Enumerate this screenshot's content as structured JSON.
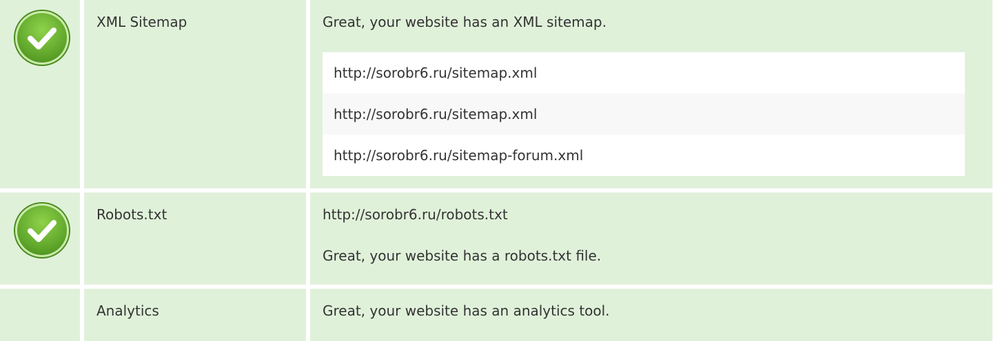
{
  "rows": [
    {
      "label": "XML Sitemap",
      "status_icon": "check-circle-icon",
      "message": "Great, your website has an XML sitemap.",
      "urls": [
        "http://sorobr6.ru/sitemap.xml",
        "http://sorobr6.ru/sitemap.xml",
        "http://sorobr6.ru/sitemap-forum.xml"
      ]
    },
    {
      "label": "Robots.txt",
      "status_icon": "check-circle-icon",
      "url": "http://sorobr6.ru/robots.txt",
      "message": "Great, your website has a robots.txt file."
    },
    {
      "label": "Analytics",
      "message": "Great, your website has an analytics tool."
    }
  ],
  "colors": {
    "row_background": "#e0f1da",
    "success_green": "#5ea52a",
    "list_odd": "#ffffff",
    "list_even": "#f8f8f8"
  }
}
